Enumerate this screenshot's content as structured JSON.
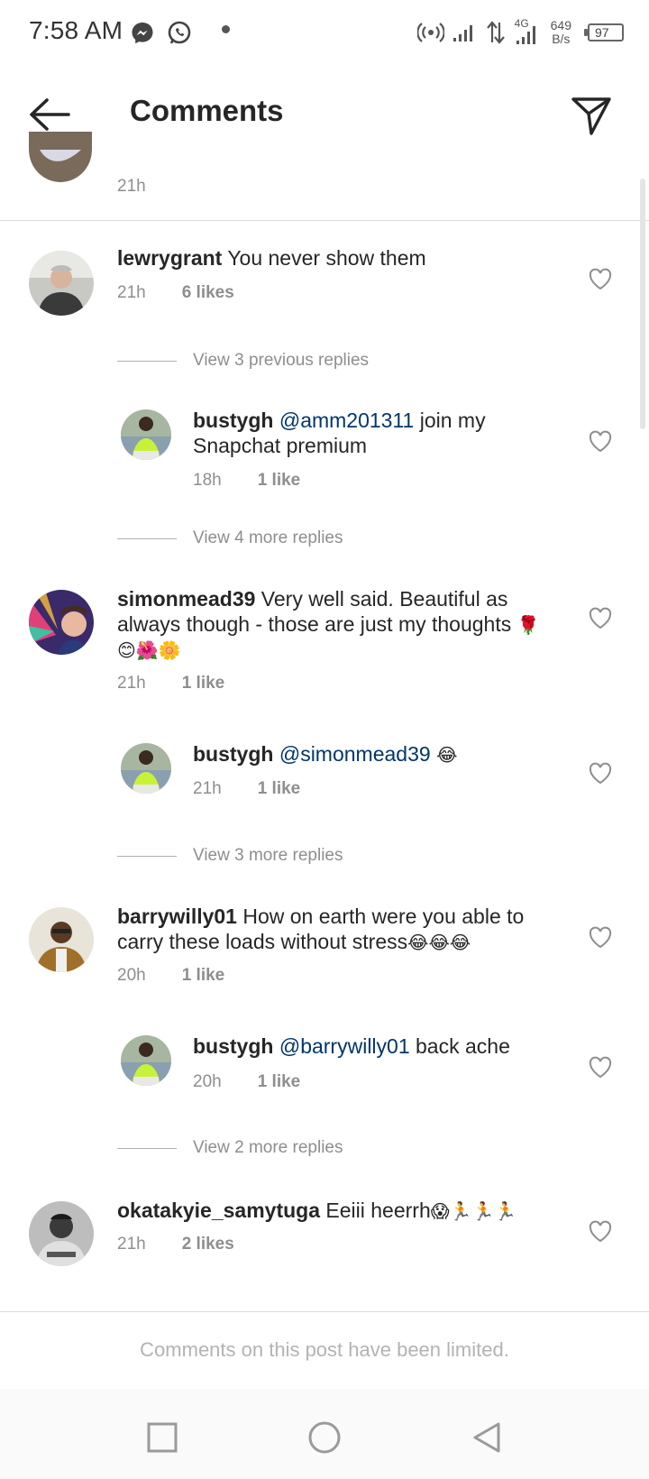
{
  "status_bar": {
    "time": "7:58 AM",
    "network_gen": "4G",
    "speed_value": "649",
    "speed_unit": "B/s",
    "battery": "97"
  },
  "header": {
    "title": "Comments"
  },
  "partial_comment": {
    "time": "21h"
  },
  "comments": [
    {
      "username": "lewrygrant",
      "text": "You never show them",
      "time": "21h",
      "likes": "6 likes",
      "view_replies": "View 3 previous replies",
      "replies": [
        {
          "username": "bustygh",
          "mention": "@amm201311",
          "text_line1": "join my",
          "text_line2": "Snapchat premium",
          "time": "18h",
          "likes": "1 like"
        }
      ],
      "more_replies": "View 4 more replies"
    },
    {
      "username": "simonmead39",
      "text_line1": "Very well said. Beautiful as",
      "text_line2": "always though - those are just my thoughts",
      "emoji_line2": "🌹",
      "emoji_line3": "😊🌺🌼",
      "time": "21h",
      "likes": "1 like",
      "replies": [
        {
          "username": "bustygh",
          "mention": "@simonmead39",
          "emoji": "😂",
          "time": "21h",
          "likes": "1 like"
        }
      ],
      "more_replies": "View 3 more replies"
    },
    {
      "username": "barrywilly01",
      "text_line1": "How on earth were you able to",
      "text_line2": "carry these loads without stress",
      "emoji_line2": "😂😂😂",
      "time": "20h",
      "likes": "1 like",
      "replies": [
        {
          "username": "bustygh",
          "mention": "@barrywilly01",
          "text": "back ache",
          "time": "20h",
          "likes": "1 like"
        }
      ],
      "more_replies": "View 2 more replies"
    },
    {
      "username": "okatakyie_samytuga",
      "text": "Eeiii heerrh",
      "emoji": "😱🏃🏃🏃",
      "time": "21h",
      "likes": "2 likes"
    }
  ],
  "footer": {
    "notice": "Comments on this post have been limited."
  },
  "icons": {
    "back": "arrow-left-icon",
    "send": "paper-plane-icon",
    "heart": "heart-outline-icon",
    "nav_recents": "square-icon",
    "nav_home": "circle-icon",
    "nav_back": "triangle-icon"
  },
  "colors": {
    "text": "#262626",
    "secondary": "#8e8e8e",
    "mention": "#00376b",
    "divider": "#dbdbdb"
  }
}
